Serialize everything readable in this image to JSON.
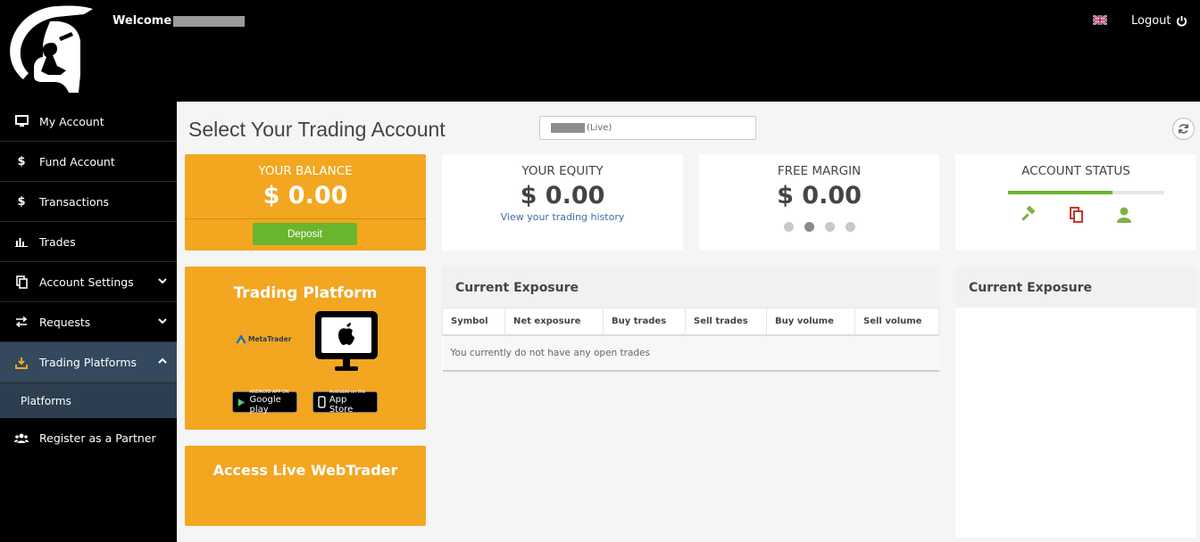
{
  "header": {
    "welcome": "Welcome",
    "logout": "Logout"
  },
  "sidebar": {
    "items": [
      {
        "label": "My Account",
        "icon": "monitor-icon"
      },
      {
        "label": "Fund Account",
        "icon": "dollar-icon"
      },
      {
        "label": "Transactions",
        "icon": "dollar-icon"
      },
      {
        "label": "Trades",
        "icon": "bar-chart-icon"
      },
      {
        "label": "Account Settings",
        "icon": "copy-icon"
      },
      {
        "label": "Requests",
        "icon": "exchange-icon"
      },
      {
        "label": "Trading Platforms",
        "icon": "download-icon"
      },
      {
        "label": "Register as a Partner",
        "icon": "users-icon"
      }
    ],
    "sub_item": "Platforms"
  },
  "main": {
    "title": "Select Your Trading Account",
    "account_suffix": "(Live)",
    "balance": {
      "label": "YOUR BALANCE",
      "amount": "$ 0.00",
      "deposit": "Deposit"
    },
    "equity": {
      "label": "YOUR EQUITY",
      "amount": "$ 0.00",
      "link": "View your trading history"
    },
    "margin": {
      "label": "FREE MARGIN",
      "amount": "$ 0.00"
    },
    "status": {
      "label": "ACCOUNT STATUS",
      "progress": 0.67
    },
    "platform": {
      "title": "Trading Platform",
      "metatrader": "MetaTrader",
      "google_small": "ANDROID APP ON",
      "google_big": "Google play",
      "apple_small": "Available on the",
      "apple_big": "App Store"
    },
    "webtrader": "Access Live WebTrader",
    "exposure": {
      "title": "Current Exposure",
      "columns": [
        "Symbol",
        "Net exposure",
        "Buy trades",
        "Sell trades",
        "Buy volume",
        "Sell volume"
      ],
      "empty": "You currently do not have any open trades"
    },
    "exposure_right_title": "Current Exposure"
  },
  "colors": {
    "orange": "#f3a620",
    "green": "#6ab52e",
    "red": "#c0392b",
    "active_nav": "#34495e"
  }
}
